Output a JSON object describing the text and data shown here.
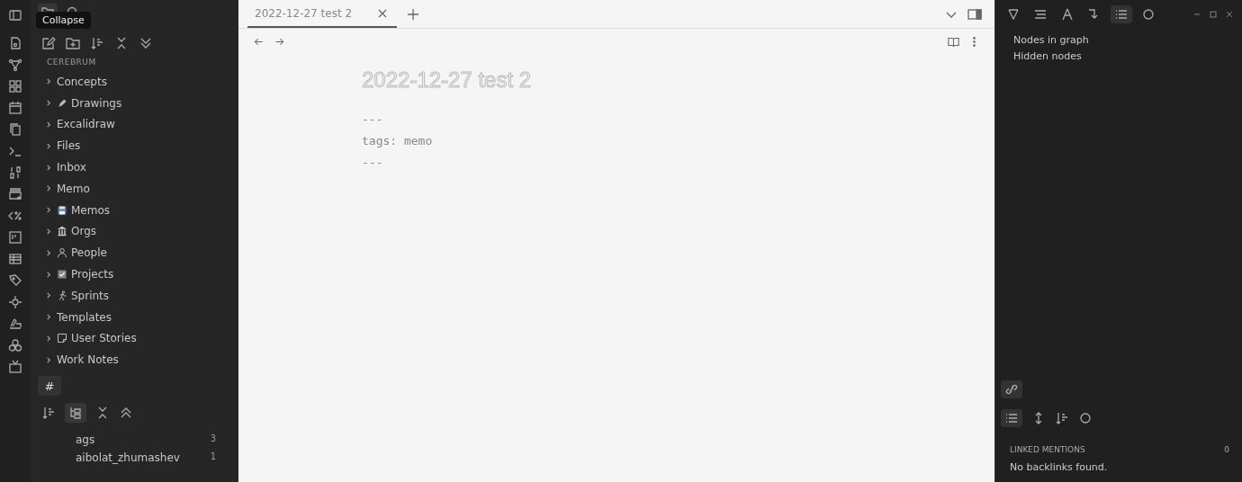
{
  "ribbon_tooltip": "Collapse",
  "left_tabs": [
    {
      "selected": true
    },
    {
      "selected": false
    }
  ],
  "file_explorer": {
    "vault_name": "CEREBRUM",
    "folders": [
      {
        "label": "Concepts",
        "kind": "plain"
      },
      {
        "label": "Drawings",
        "kind": "pen"
      },
      {
        "label": "Excalidraw",
        "kind": "plain"
      },
      {
        "label": "Files",
        "kind": "plain"
      },
      {
        "label": "Inbox",
        "kind": "plain"
      },
      {
        "label": "Memo",
        "kind": "plain"
      },
      {
        "label": "Memos",
        "kind": "disk"
      },
      {
        "label": "Orgs",
        "kind": "building"
      },
      {
        "label": "People",
        "kind": "person"
      },
      {
        "label": "Projects",
        "kind": "check"
      },
      {
        "label": "Sprints",
        "kind": "runner"
      },
      {
        "label": "Templates",
        "kind": "plain"
      },
      {
        "label": "User Stories",
        "kind": "note"
      },
      {
        "label": "Work Notes",
        "kind": "plain"
      }
    ]
  },
  "tag_pane": {
    "tab_label": "#",
    "tags": [
      {
        "name": "ags",
        "count": "3"
      },
      {
        "name": "aibolat_zhumashev",
        "count": "1"
      }
    ]
  },
  "tabs": [
    {
      "title": "2022-12-27 test 2",
      "selected": true
    }
  ],
  "note": {
    "title": "2022-12-27 test 2",
    "lines": [
      "---",
      "tags: memo",
      "---"
    ]
  },
  "right_toolbar": [
    {
      "selected": false
    },
    {
      "selected": false
    },
    {
      "selected": false
    },
    {
      "selected": false
    },
    {
      "selected": true
    },
    {
      "selected": false
    }
  ],
  "graph_info": [
    "Nodes in graph",
    "Hidden nodes"
  ],
  "backlinks": {
    "heading": "LINKED MENTIONS",
    "count": "0",
    "empty": "No backlinks found."
  }
}
